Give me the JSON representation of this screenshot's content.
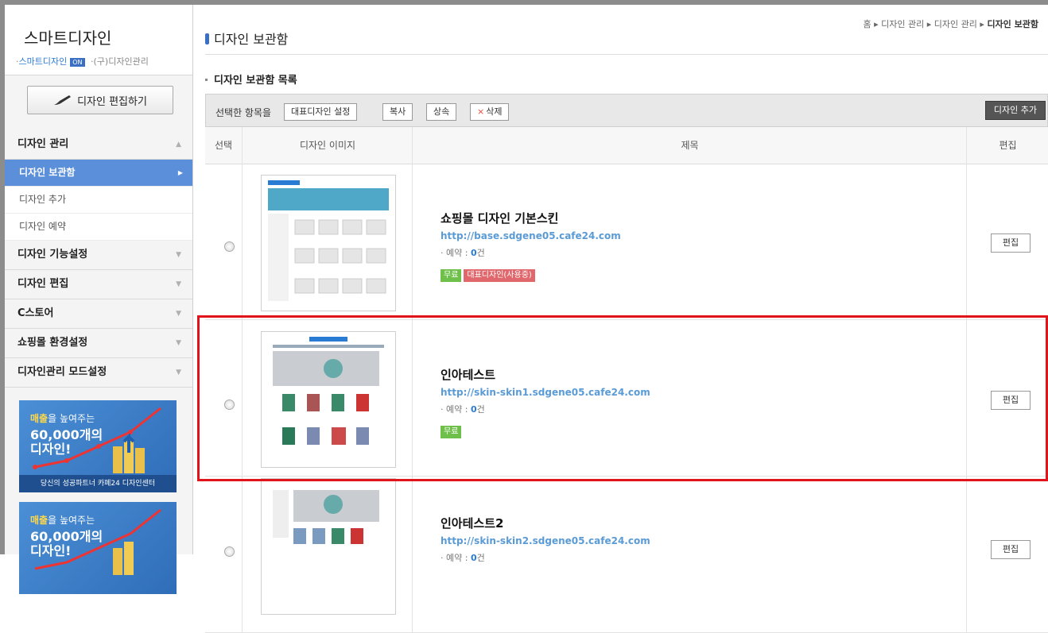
{
  "sidebar": {
    "title": "스마트디자인",
    "sub_active": "스마트디자인",
    "on_badge": "ON",
    "sub_other": "(구)디자인관리",
    "edit_button": "디자인 편집하기",
    "menu": {
      "design_manage": "디자인 관리",
      "items": [
        "디자인 보관함",
        "디자인 추가",
        "디자인 예약"
      ],
      "design_function": "디자인 기능설정",
      "design_edit": "디자인 편집",
      "c_store": "C스토어",
      "mall_settings": "쇼핑몰 환경설정",
      "design_mode": "디자인관리 모드설정"
    },
    "banner": {
      "line1_highlight": "매출",
      "line1_rest": "을 높여주는",
      "line2": "60,000개의",
      "line3": "디자인!",
      "footer": "당신의 성공파트너 카페24 디자인센터"
    }
  },
  "breadcrumb": {
    "home": "홈",
    "sep": "▸",
    "level1": "디자인 관리",
    "level2": "디자인 관리",
    "current": "디자인 보관함"
  },
  "page_title": "디자인 보관함",
  "section_title": "디자인 보관함 목록",
  "toolbar": {
    "label": "선택한 항목을",
    "set_main": "대표디자인 설정",
    "copy": "복사",
    "inherit": "상속",
    "delete": "삭제",
    "add_design": "디자인 추가"
  },
  "table": {
    "headers": {
      "select": "선택",
      "image": "디자인 이미지",
      "title": "제목",
      "edit": "편집"
    },
    "rows": [
      {
        "name": "쇼핑몰 디자인 기본스킨",
        "url": "http://base.sdgene05.cafe24.com",
        "reservation_label": "예약 :",
        "reservation_count": "0",
        "reservation_unit": "건",
        "tag_free": "무료",
        "tag_main": "대표디자인(사용중)",
        "edit": "편집"
      },
      {
        "name": "인아테스트",
        "url": "http://skin-skin1.sdgene05.cafe24.com",
        "reservation_label": "예약 :",
        "reservation_count": "0",
        "reservation_unit": "건",
        "tag_free": "무료",
        "edit": "편집"
      },
      {
        "name": "인아테스트2",
        "url": "http://skin-skin2.sdgene05.cafe24.com",
        "reservation_label": "예약 :",
        "reservation_count": "0",
        "reservation_unit": "건",
        "edit": "편집"
      }
    ]
  },
  "colors": {
    "accent": "#5b8fd9",
    "highlight": "#e0141a",
    "tag_free": "#6ec04a",
    "tag_main": "#e0676b",
    "url": "#5a9bd5"
  },
  "icons": {
    "brush": "paint-brush-icon",
    "menu_arrow": "triangle-down-icon",
    "active_arrow": "triangle-right-icon",
    "delete_mark": "x-icon"
  }
}
